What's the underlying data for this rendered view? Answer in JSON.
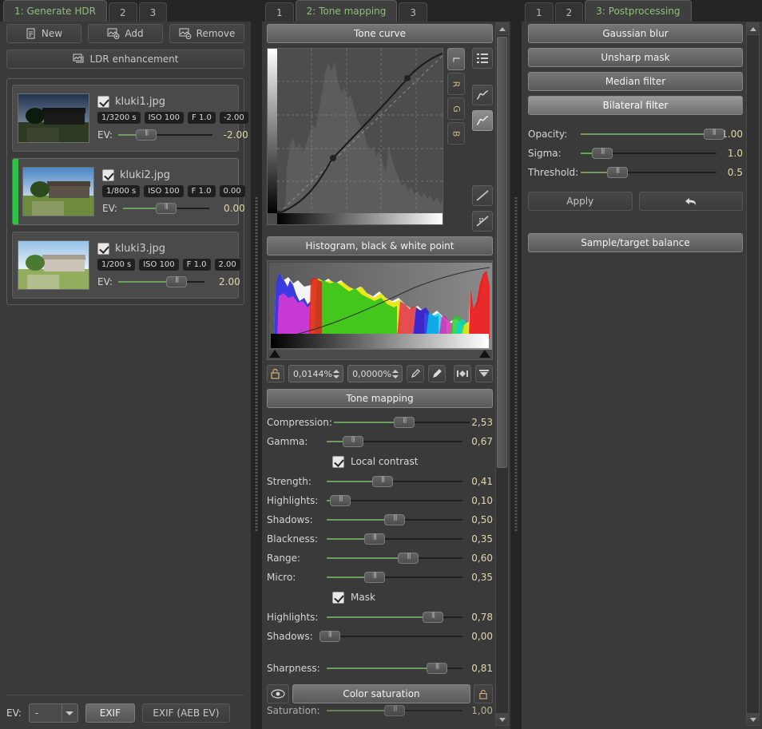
{
  "left_panel": {
    "tabs": [
      {
        "label": "1: Generate HDR",
        "active": true
      },
      {
        "label": "2",
        "active": false
      },
      {
        "label": "3",
        "active": false
      }
    ],
    "buttons": {
      "new": "New",
      "add": "Add",
      "remove": "Remove",
      "ldr_enhancement": "LDR enhancement"
    },
    "images": [
      {
        "filename": "kluki1.jpg",
        "checked": true,
        "selected": false,
        "shutter": "1/3200 s",
        "iso": "ISO 100",
        "aperture": "F 1.0",
        "ev_tag": "-2.00",
        "ev_label": "EV:",
        "ev_value": "-2.00",
        "ev_slider_pct": 30,
        "thumb_style": "t-dark"
      },
      {
        "filename": "kluki2.jpg",
        "checked": true,
        "selected": true,
        "shutter": "1/800 s",
        "iso": "ISO 100",
        "aperture": "F 1.0",
        "ev_tag": "0.00",
        "ev_label": "EV:",
        "ev_value": "0.00",
        "ev_slider_pct": 50,
        "thumb_style": "t-mid"
      },
      {
        "filename": "kluki3.jpg",
        "checked": true,
        "selected": false,
        "shutter": "1/200 s",
        "iso": "ISO 100",
        "aperture": "F 1.0",
        "ev_tag": "2.00",
        "ev_label": "EV:",
        "ev_value": "2.00",
        "ev_slider_pct": 68,
        "thumb_style": "t-bright"
      }
    ],
    "bottom": {
      "ev_label": "EV:",
      "combo_value": "-",
      "exif_button": "EXIF",
      "exif_aeb_button": "EXIF (AEB EV)"
    }
  },
  "middle_panel": {
    "tabs": [
      {
        "label": "1",
        "active": false
      },
      {
        "label": "2: Tone mapping",
        "active": true
      },
      {
        "label": "3",
        "active": false
      }
    ],
    "tone_curve": {
      "title": "Tone curve",
      "channels": [
        "L",
        "R",
        "G",
        "B"
      ],
      "active_channel": "L"
    },
    "histogram": {
      "title": "Histogram, black & white point",
      "black_point": "0,0144%",
      "white_point": "0,0000%"
    },
    "tone_mapping": {
      "title": "Tone mapping",
      "sliders": [
        {
          "label": "Compression:",
          "value": "2,53",
          "pct": 52
        },
        {
          "label": "Gamma:",
          "value": "0,67",
          "pct": 19
        }
      ],
      "local_contrast": {
        "label": "Local contrast",
        "checked": true
      },
      "local_sliders": [
        {
          "label": "Strength:",
          "value": "0,41",
          "pct": 41
        },
        {
          "label": "Highlights:",
          "value": "0,10",
          "pct": 10
        },
        {
          "label": "Shadows:",
          "value": "0,50",
          "pct": 50
        },
        {
          "label": "Blackness:",
          "value": "0,35",
          "pct": 35
        },
        {
          "label": "Range:",
          "value": "0,60",
          "pct": 60
        },
        {
          "label": "Micro:",
          "value": "0,35",
          "pct": 35
        }
      ],
      "mask": {
        "label": "Mask",
        "checked": true
      },
      "mask_sliders": [
        {
          "label": "Highlights:",
          "value": "0,78",
          "pct": 78
        },
        {
          "label": "Shadows:",
          "value": "0,00",
          "pct": 0
        }
      ],
      "sharpness": {
        "label": "Sharpness:",
        "value": "0,81",
        "pct": 81
      }
    },
    "color_saturation": {
      "title": "Color saturation"
    }
  },
  "right_panel": {
    "tabs": [
      {
        "label": "1",
        "active": false
      },
      {
        "label": "2",
        "active": false
      },
      {
        "label": "3: Postprocessing",
        "active": true
      }
    ],
    "filters": [
      {
        "label": "Gaussian blur",
        "active": false
      },
      {
        "label": "Unsharp mask",
        "active": false
      },
      {
        "label": "Median filter",
        "active": false
      },
      {
        "label": "Bilateral filter",
        "active": true
      }
    ],
    "sliders": [
      {
        "label": "Opacity:",
        "value": "1.00",
        "pct": 100
      },
      {
        "label": "Sigma:",
        "value": "1.0",
        "pct": 16
      },
      {
        "label": "Threshold:",
        "value": "0.5",
        "pct": 27
      }
    ],
    "apply_button": "Apply",
    "sample_target_balance": "Sample/target balance"
  },
  "colors": {
    "active_tab_text": "#8fbf7a",
    "value_text": "#e3d7a8",
    "selection_bar": "#2fc246",
    "slider_fill": "#6d9e5e",
    "panel_bg": "#3a3a3a",
    "window_bg": "#252525"
  }
}
